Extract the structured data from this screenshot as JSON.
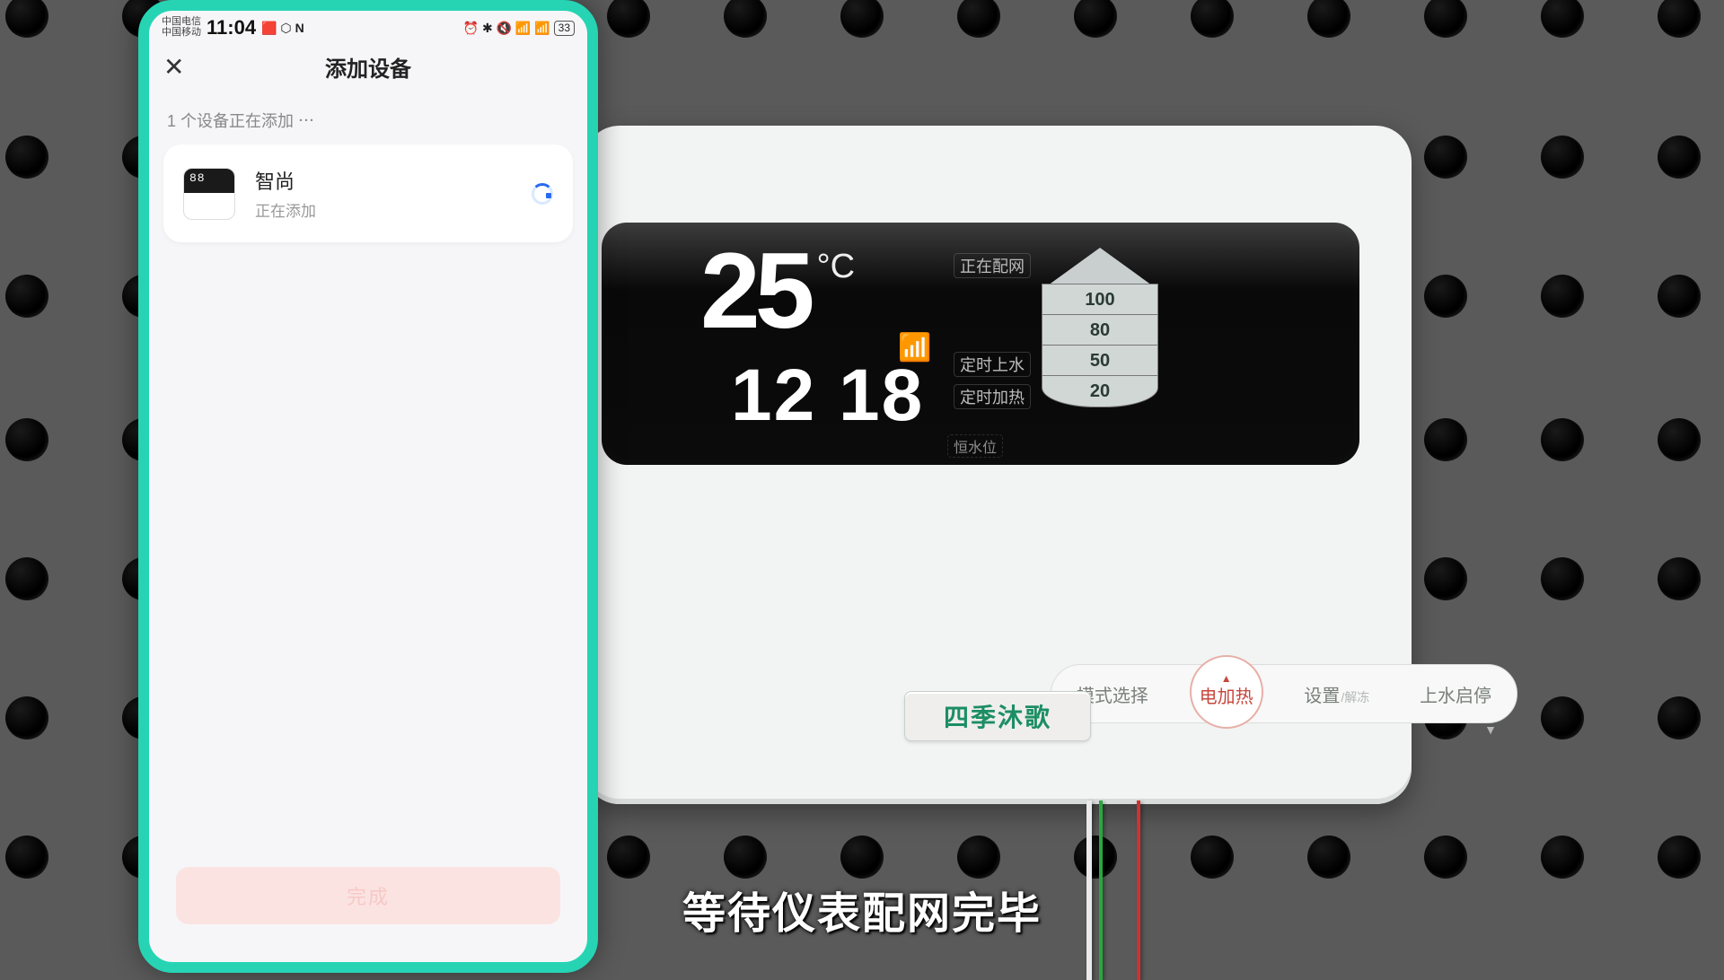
{
  "phone": {
    "statusbar": {
      "carrier1": "中国电信",
      "carrier2": "中国移动",
      "time": "11:04",
      "battery": "33"
    },
    "nav_title": "添加设备",
    "hint": "1 个设备正在添加",
    "device": {
      "name": "智尚",
      "status": "正在添加"
    },
    "done_label": "完成"
  },
  "panel": {
    "temperature": "25",
    "temp_unit": "°C",
    "time": "12 18",
    "labels": {
      "pairing": "正在配网",
      "timer_fill": "定时上水",
      "timer_heat": "定时加热",
      "keep_level": "恒水位"
    },
    "tank_levels": [
      "100",
      "80",
      "50",
      "20"
    ],
    "buttons": {
      "mode": "模式选择",
      "heat": "电加热",
      "settings": "设置",
      "settings_sub": "/解冻",
      "fill": "上水启停"
    },
    "brand": "四季沐歌"
  },
  "caption": "等待仪表配网完毕"
}
